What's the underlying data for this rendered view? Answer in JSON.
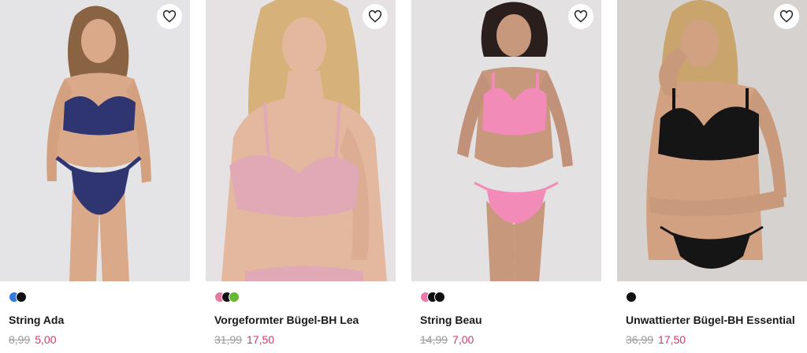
{
  "products": [
    {
      "name": "String Ada",
      "old_price": "8,99",
      "new_price": "5,00",
      "image_label": "Model wearing navy lace bra and string",
      "background": "#e4e3e5",
      "garment_color": "#2e3570",
      "swatches": [
        "#2f7be0",
        "#111111"
      ]
    },
    {
      "name": "Vorgeformter Bügel-BH Lea",
      "old_price": "31,99",
      "new_price": "17,50",
      "image_label": "Model wearing pink moulded lace bra",
      "background": "#e6e2e4",
      "garment_color": "#e0a9b5",
      "swatches": [
        "#e57aa3",
        "#111111",
        "#67b832"
      ]
    },
    {
      "name": "String Beau",
      "old_price": "14,99",
      "new_price": "7,00",
      "image_label": "Model wearing pink embroidered bra and string",
      "background": "#e3e1e2",
      "garment_color": "#f28bb8",
      "swatches": [
        "#e97aa9",
        "#111111",
        "#111111"
      ]
    },
    {
      "name": "Unwattierter Bügel-BH Essential",
      "old_price": "36,99",
      "new_price": "17,50",
      "image_label": "Model wearing black unpadded bra and string",
      "background": "#d6d2d0",
      "garment_color": "#151515",
      "swatches": [
        "#111111"
      ]
    }
  ],
  "icons": {
    "favorite": "heart-outline-icon"
  }
}
